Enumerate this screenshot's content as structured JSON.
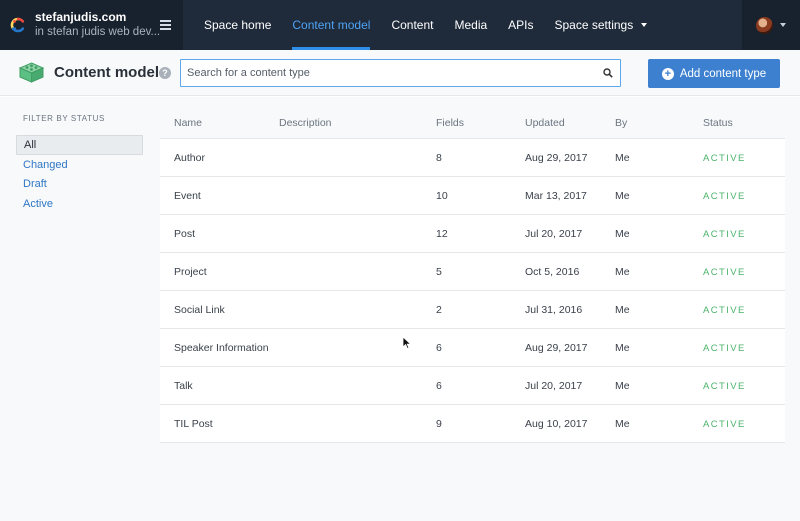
{
  "space": {
    "name": "stefanjudis.com",
    "org": "in stefan judis web dev..."
  },
  "nav": [
    {
      "label": "Space home",
      "active": false,
      "dropdown": false
    },
    {
      "label": "Content model",
      "active": true,
      "dropdown": false
    },
    {
      "label": "Content",
      "active": false,
      "dropdown": false
    },
    {
      "label": "Media",
      "active": false,
      "dropdown": false
    },
    {
      "label": "APIs",
      "active": false,
      "dropdown": false
    },
    {
      "label": "Space settings",
      "active": false,
      "dropdown": true
    }
  ],
  "page": {
    "title": "Content model",
    "help": "?"
  },
  "search": {
    "placeholder": "Search for a content type",
    "value": ""
  },
  "add_button": {
    "label": "Add content type"
  },
  "filter": {
    "title": "FILTER BY STATUS",
    "items": [
      "All",
      "Changed",
      "Draft",
      "Active"
    ],
    "selected": "All"
  },
  "table": {
    "columns": {
      "name": "Name",
      "description": "Description",
      "fields": "Fields",
      "updated": "Updated",
      "by": "By",
      "status": "Status"
    },
    "rows": [
      {
        "name": "Author",
        "description": "",
        "fields": "8",
        "updated": "Aug 29, 2017",
        "by": "Me",
        "status": "ACTIVE"
      },
      {
        "name": "Event",
        "description": "",
        "fields": "10",
        "updated": "Mar 13, 2017",
        "by": "Me",
        "status": "ACTIVE"
      },
      {
        "name": "Post",
        "description": "",
        "fields": "12",
        "updated": "Jul 20, 2017",
        "by": "Me",
        "status": "ACTIVE"
      },
      {
        "name": "Project",
        "description": "",
        "fields": "5",
        "updated": "Oct 5, 2016",
        "by": "Me",
        "status": "ACTIVE"
      },
      {
        "name": "Social Link",
        "description": "",
        "fields": "2",
        "updated": "Jul 31, 2016",
        "by": "Me",
        "status": "ACTIVE"
      },
      {
        "name": "Speaker Information",
        "description": "",
        "fields": "6",
        "updated": "Aug 29, 2017",
        "by": "Me",
        "status": "ACTIVE"
      },
      {
        "name": "Talk",
        "description": "",
        "fields": "6",
        "updated": "Jul 20, 2017",
        "by": "Me",
        "status": "ACTIVE"
      },
      {
        "name": "TIL Post",
        "description": "",
        "fields": "9",
        "updated": "Aug 10, 2017",
        "by": "Me",
        "status": "ACTIVE"
      }
    ]
  },
  "icons": {
    "logo": "contentful-logo-icon",
    "menu": "hamburger-menu-icon",
    "content_model": "content-model-blocks-icon",
    "search": "search-icon",
    "add": "plus-circle-icon",
    "avatar": "user-avatar"
  },
  "colors": {
    "accent": "#2e8ee8",
    "nav_bg": "#1f2a3a",
    "button": "#3c80cf",
    "status_active": "#4bb36b"
  }
}
